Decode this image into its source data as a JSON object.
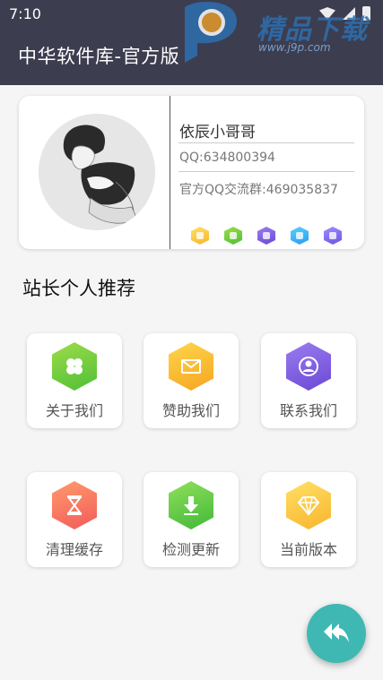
{
  "status": {
    "time": "7:10"
  },
  "header": {
    "title": "中华软件库-官方版"
  },
  "watermark": {
    "brand": "精品下载",
    "url": "www.j9p.com"
  },
  "profile": {
    "name": "依辰小哥哥",
    "qq": "QQ:634800394",
    "group": "官方QQ交流群:469035837",
    "badges": [
      "gold-diamond-badge",
      "android-badge",
      "play-badge",
      "snowflake-badge",
      "moon-badge"
    ]
  },
  "section": {
    "title": "站长个人推荐"
  },
  "tiles": [
    {
      "label": "关于我们",
      "icon": "clover-icon"
    },
    {
      "label": "赞助我们",
      "icon": "mail-icon"
    },
    {
      "label": "联系我们",
      "icon": "user-icon"
    },
    {
      "label": "清理缓存",
      "icon": "hourglass-icon"
    },
    {
      "label": "检测更新",
      "icon": "download-icon"
    },
    {
      "label": "当前版本",
      "icon": "diamond-icon"
    }
  ],
  "fab": {
    "icon": "reply-all-icon"
  },
  "colors": {
    "appbar": "#3d3d50",
    "fab": "#3fb8b3"
  }
}
